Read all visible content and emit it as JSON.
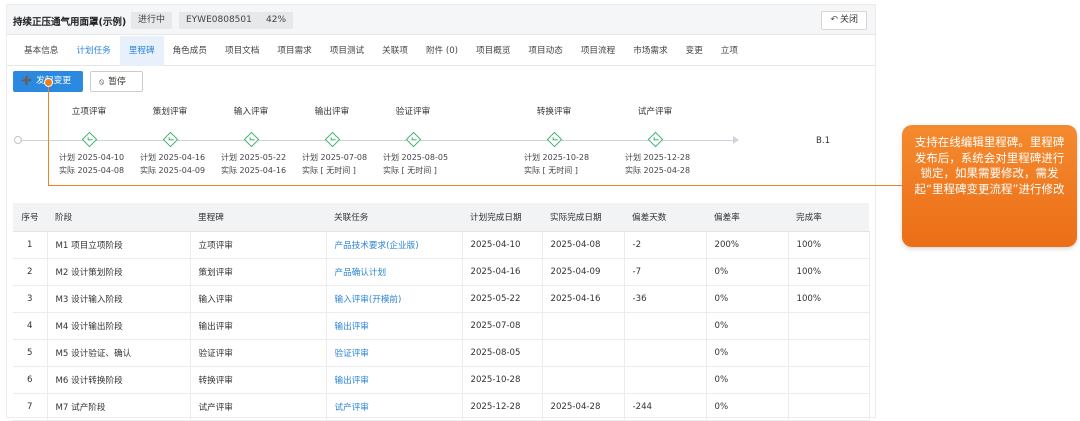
{
  "header": {
    "project_title": "持续正压通气用面罩(示例)",
    "status_tag": "进行中",
    "code_tag": "EYWE0808501",
    "progress_tag": "42%",
    "close_label": "关闭"
  },
  "tabs": [
    {
      "label": "基本信息"
    },
    {
      "label": "计划任务"
    },
    {
      "label": "里程碑"
    },
    {
      "label": "角色成员"
    },
    {
      "label": "项目文档"
    },
    {
      "label": "项目需求"
    },
    {
      "label": "项目测试"
    },
    {
      "label": "关联项"
    },
    {
      "label": "附件 (0)"
    },
    {
      "label": "项目概览"
    },
    {
      "label": "项目动态"
    },
    {
      "label": "项目流程"
    },
    {
      "label": "市场需求"
    },
    {
      "label": "变更"
    },
    {
      "label": "立项"
    }
  ],
  "actions": {
    "change_label": "发起变更",
    "pause_label": "暂停"
  },
  "timeline": {
    "end_label": "B.1",
    "milestones": [
      {
        "name": "立项评审",
        "plan": "计划  2025-04-10",
        "actual": "实际  2025-04-08"
      },
      {
        "name": "策划评审",
        "plan": "计划  2025-04-16",
        "actual": "实际  2025-04-09"
      },
      {
        "name": "输入评审",
        "plan": "计划  2025-05-22",
        "actual": "实际  2025-04-16"
      },
      {
        "name": "输出评审",
        "plan": "计划  2025-07-08",
        "actual": "实际  [ 无时间 ]"
      },
      {
        "name": "验证评审",
        "plan": "计划  2025-08-05",
        "actual": "实际  [ 无时间 ]"
      },
      {
        "name": "转换评审",
        "plan": "计划  2025-10-28",
        "actual": "实际  [ 无时间 ]"
      },
      {
        "name": "试产评审",
        "plan": "计划  2025-12-28",
        "actual": "实际  2025-04-28"
      }
    ]
  },
  "table": {
    "columns": [
      "序号",
      "阶段",
      "里程碑",
      "关联任务",
      "计划完成日期",
      "实际完成日期",
      "偏差天数",
      "偏差率",
      "完成率"
    ],
    "rows": [
      {
        "no": "1",
        "stage": "M1 项目立项阶段",
        "milestone": "立项评审",
        "task": "产品技术要求(企业版)",
        "plan": "2025-04-10",
        "actual": "2025-04-08",
        "days": "-2",
        "rate": "200%",
        "done": "100%"
      },
      {
        "no": "2",
        "stage": "M2 设计策划阶段",
        "milestone": "策划评审",
        "task": "产品确认计划",
        "plan": "2025-04-16",
        "actual": "2025-04-09",
        "days": "-7",
        "rate": "0%",
        "done": "100%"
      },
      {
        "no": "3",
        "stage": "M3 设计输入阶段",
        "milestone": "输入评审",
        "task": "输入评审(开模前)",
        "plan": "2025-05-22",
        "actual": "2025-04-16",
        "days": "-36",
        "rate": "0%",
        "done": "100%"
      },
      {
        "no": "4",
        "stage": "M4 设计输出阶段",
        "milestone": "输出评审",
        "task": "输出评审",
        "plan": "2025-07-08",
        "actual": "",
        "days": "",
        "rate": "0%",
        "done": ""
      },
      {
        "no": "5",
        "stage": "M5 设计验证、确认",
        "milestone": "验证评审",
        "task": "验证评审",
        "plan": "2025-08-05",
        "actual": "",
        "days": "",
        "rate": "0%",
        "done": ""
      },
      {
        "no": "6",
        "stage": "M6 设计转换阶段",
        "milestone": "转换评审",
        "task": "输出评审",
        "plan": "2025-10-28",
        "actual": "",
        "days": "",
        "rate": "0%",
        "done": ""
      },
      {
        "no": "7",
        "stage": "M7 试产阶段",
        "milestone": "试产评审",
        "task": "试产评审",
        "plan": "2025-12-28",
        "actual": "2025-04-28",
        "days": "-244",
        "rate": "0%",
        "done": ""
      }
    ]
  },
  "callout": {
    "text": "支持在线编辑里程碑。里程碑发布后，系统会对里程碑进行锁定，如果需要修改，需发起“里程碑变更流程”进行修改"
  }
}
